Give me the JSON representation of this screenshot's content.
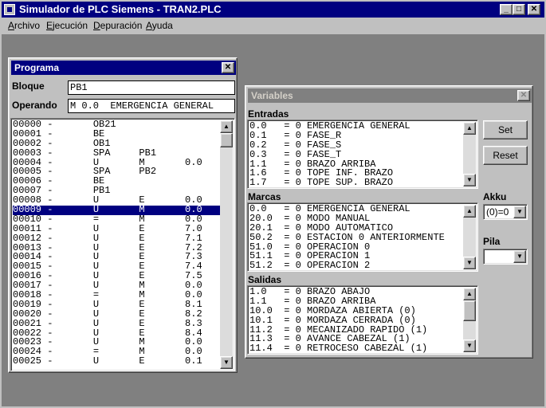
{
  "window": {
    "title": "Simulador de PLC Siemens - TRAN2.PLC",
    "minimize": "_",
    "maximize": "□",
    "close": "✕"
  },
  "menu": {
    "items": [
      {
        "ul": "A",
        "rest": "rchivo"
      },
      {
        "ul": "E",
        "rest": "jecución"
      },
      {
        "ul": "D",
        "rest": "epuración"
      },
      {
        "ul": "A",
        "rest": "yuda"
      }
    ]
  },
  "programa": {
    "title": "Programa",
    "close": "✕",
    "bloque_label": "Bloque",
    "bloque_value": "PB1",
    "operando_label": "Operando",
    "operando_value": "M 0.0  EMERGENCIA GENERAL",
    "rows": [
      "00000 -       OB21",
      "00001 -       BE",
      "00002 -       OB1",
      "00003 -       SPA     PB1",
      "00004 -       U       M       0.0",
      "00005 -       SPA     PB2",
      "00006 -       BE",
      "00007 -       PB1",
      "00008 -       U       E       0.0",
      "00009 -       U       M       0.0",
      "00010 -       =       M       0.0",
      "00011 -       U       E       7.0",
      "00012 -       U       E       7.1",
      "00013 -       U       E       7.2",
      "00014 -       U       E       7.3",
      "00015 -       U       E       7.4",
      "00016 -       U       E       7.5",
      "00017 -       U       M       0.0",
      "00018 -       =       M       0.0",
      "00019 -       U       E       8.1",
      "00020 -       U       E       8.2",
      "00021 -       U       E       8.3",
      "00022 -       U       E       8.4",
      "00023 -       U       M       0.0",
      "00024 -       =       M       0.0",
      "00025 -       U       E       0.1"
    ],
    "selected_row": 9
  },
  "variables": {
    "title": "Variables",
    "close": "✕",
    "entradas_label": "Entradas",
    "entradas": [
      "0.0   = 0 EMERGENCIA GENERAL",
      "0.1   = 0 FASE_R",
      "0.2   = 0 FASE_S",
      "0.3   = 0 FASE_T",
      "1.1   = 0 BRAZO ARRIBA",
      "1.6   = 0 TOPE INF. BRAZO",
      "1.7   = 0 TOPE SUP. BRAZO"
    ],
    "marcas_label": "Marcas",
    "marcas": [
      "0.0   = 0 EMERGENCIA GENERAL",
      "20.0  = 0 MODO MANUAL",
      "20.1  = 0 MODO AUTOMATICO",
      "50.2  = 0 ESTACION 0 ANTERIORMENTE",
      "51.0  = 0 OPERACION 0",
      "51.1  = 0 OPERACION 1",
      "51.2  = 0 OPERACION 2"
    ],
    "salidas_label": "Salidas",
    "salidas": [
      "1.0   = 0 BRAZO ABAJO",
      "1.1   = 0 BRAZO ARRIBA",
      "10.0  = 0 MORDAZA ABIERTA (0)",
      "10.1  = 0 MORDAZA CERRADA (0)",
      "11.2  = 0 MECANIZADO RAPIDO (1)",
      "11.3  = 0 AVANCE CABEZAL (1)",
      "11.4  = 0 RETROCESO CABEZAL (1)"
    ],
    "set_label": "Set",
    "reset_label": "Reset",
    "akku_label": "Akku",
    "akku_value": "(0)=0",
    "pila_label": "Pila",
    "pila_value": ""
  }
}
